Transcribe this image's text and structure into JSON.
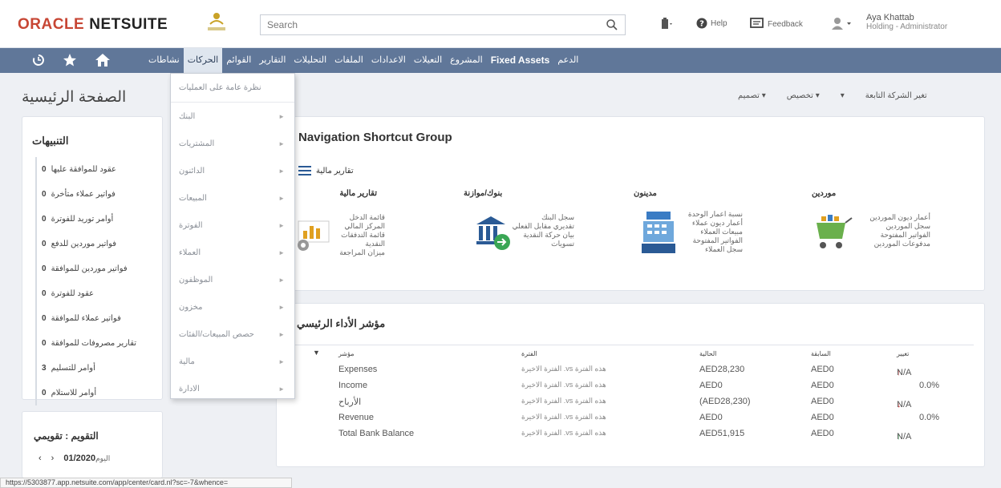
{
  "header": {
    "logo_oracle": "ORACLE",
    "logo_netsuite": "NETSUITE",
    "search_placeholder": "Search",
    "help": "Help",
    "feedback": "Feedback",
    "user_name": "Aya Khattab",
    "user_role": "Holding - Administrator"
  },
  "nav": {
    "items": [
      "نشاطات",
      "الحركات",
      "القوائم",
      "التقارير",
      "التحليلات",
      "الملفات",
      "الاعدادات",
      "التعيلات",
      "المشروع",
      "Fixed Assets",
      "الدعم"
    ]
  },
  "page": {
    "title": "الصفحة الرئيسية",
    "actions": [
      "تغير الشركة التابعة",
      "تخصيص",
      "تصميم"
    ]
  },
  "dropdown": {
    "items": [
      "نظرة عامة على العمليات",
      "البنك",
      "المشتريات",
      "الدائنون",
      "المبيعات",
      "الفوترة",
      "العملاء",
      "الموظفون",
      "مخزون",
      "حصص المبيعات/الفئات",
      "مالية",
      "الادارة"
    ]
  },
  "reminders": {
    "title": "التنبيهات",
    "items": [
      {
        "count": "0",
        "label": "عقود للموافقة عليها"
      },
      {
        "count": "0",
        "label": "فواتير عملاء متأخرة"
      },
      {
        "count": "0",
        "label": "أوامر توريد للفوترة"
      },
      {
        "count": "0",
        "label": "فواتير موردين للدفع"
      },
      {
        "count": "0",
        "label": "فواتير موردين للموافقة"
      },
      {
        "count": "0",
        "label": "عقود للفوترة"
      },
      {
        "count": "0",
        "label": "فواتير عملاء للموافقة"
      },
      {
        "count": "0",
        "label": "تقارير مصروفات للموافقة"
      },
      {
        "count": "3",
        "label": "أوامر للتسليم"
      },
      {
        "count": "0",
        "label": "أوامر للاستلام"
      }
    ]
  },
  "shortcuts": {
    "title": "Navigation Shortcut Group",
    "link": "تقارير مالية",
    "groups": [
      {
        "heading": "تقارير مالية",
        "lines": [
          "قائمة الدخل",
          "المركز المالي",
          "قائمة التدفقات النقدية",
          "ميزان المراجعة"
        ]
      },
      {
        "heading": "بنوك/موازنة",
        "lines": [
          "سجل البنك",
          "تقديري مقابل الفعلي",
          "بيان حركة النقدية",
          "تسويات"
        ]
      },
      {
        "heading": "مدينون",
        "lines": [
          "نسبة اعمار الوحدة",
          "أعمار ديون عملاء",
          "مبيعات العملاء",
          "الفواتير المفتوحة",
          "سجل العملاء"
        ]
      },
      {
        "heading": "موردين",
        "lines": [
          "أعمار ديون الموردين",
          "سجل الموردين",
          "الفواتير المفتوحة",
          "مدفوعات الموردين"
        ]
      }
    ]
  },
  "kpi": {
    "title": "مؤشر الأداء الرئيسي",
    "headers": [
      "مؤشر",
      "الفترة",
      "الحالية",
      "السابقة",
      "تغيير"
    ],
    "rows": [
      {
        "indicator": "Expenses",
        "period": "الفترة الاخيرة .vs هذه الفترة",
        "current": "AED28,230",
        "previous": "AED0",
        "change": "N/A",
        "trend": "up-red"
      },
      {
        "indicator": "Income",
        "period": "الفترة الاخيرة .vs هذه الفترة",
        "current": "AED0",
        "previous": "AED0",
        "change": "0.0%",
        "trend": "none"
      },
      {
        "indicator": "الأرباح",
        "period": "الفترة الاخيرة .vs هذه الفترة",
        "current": "(AED28,230)",
        "previous": "AED0",
        "change": "N/A",
        "trend": "down"
      },
      {
        "indicator": "Revenue",
        "period": "الفترة الاخيرة .vs هذه الفترة",
        "current": "AED0",
        "previous": "AED0",
        "change": "0.0%",
        "trend": "none"
      },
      {
        "indicator": "Total Bank Balance",
        "period": "الفترة الاخيرة .vs هذه الفترة",
        "current": "AED51,915",
        "previous": "AED0",
        "change": "N/A",
        "trend": "up"
      }
    ]
  },
  "calendar": {
    "title": "التقويم : تقويمي",
    "date": "01/2020",
    "day_prefix": "اليوم"
  },
  "statusbar": {
    "url": "https://5303877.app.netsuite.com/app/center/card.nl?sc=-7&whence="
  },
  "colors": {
    "nav_bg": "#607799",
    "oracle_red": "#c74634",
    "up_green": "#3aa655",
    "down_red": "#d13a3a"
  }
}
